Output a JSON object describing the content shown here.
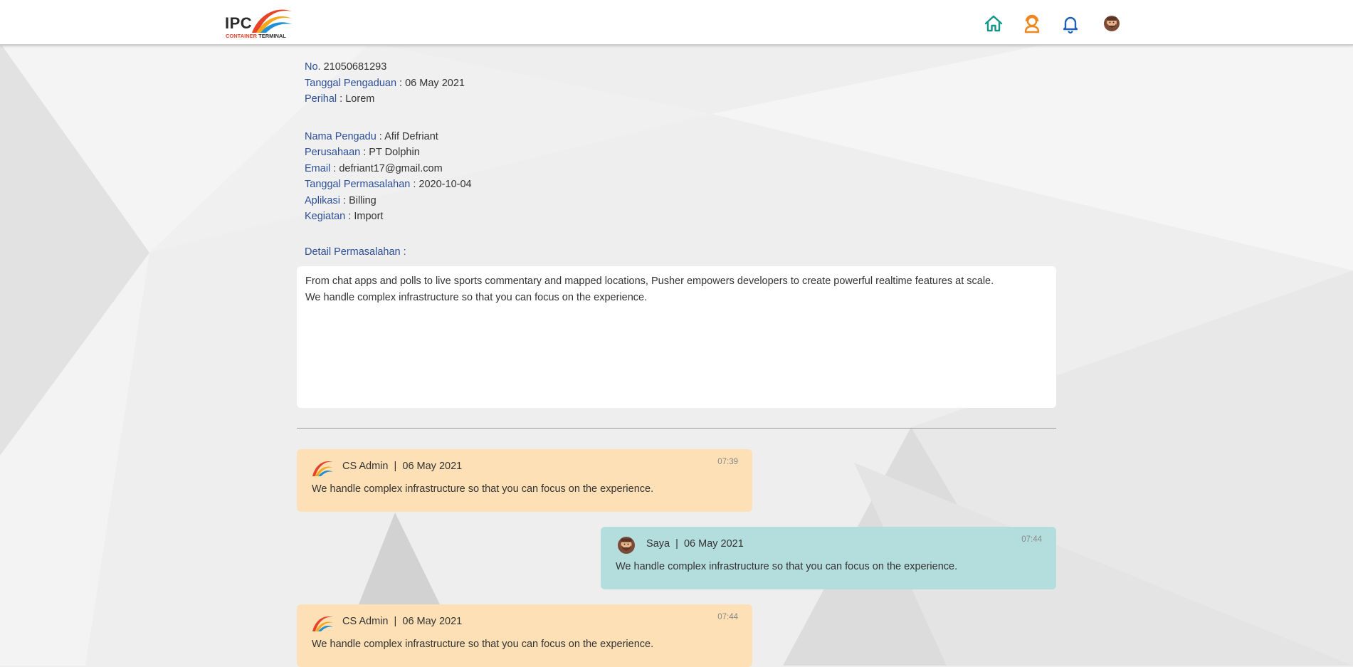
{
  "brand": {
    "logo_text": "IPC",
    "logo_sub_1": "CONTAINER",
    "logo_sub_2": "TERMINAL"
  },
  "nav": {
    "icons": [
      "home-icon",
      "support-agent-icon",
      "bell-icon",
      "user-avatar-icon"
    ],
    "colors": {
      "home": "#14958a",
      "support": "#f0861e",
      "bell": "#1f5fb8"
    }
  },
  "ticket": {
    "no_label": "No.",
    "no_value": "21050681293",
    "date_label": "Tanggal Pengaduan",
    "date_value": "06 May 2021",
    "subject_label": "Perihal",
    "subject_value": "Lorem",
    "name_label": "Nama Pengadu",
    "name_value": "Afif Defriant",
    "company_label": "Perusahaan",
    "company_value": "PT Dolphin",
    "email_label": "Email",
    "email_value": "defriant17@gmail.com",
    "problem_date_label": "Tanggal Permasalahan",
    "problem_date_value": "2020-10-04",
    "app_label": "Aplikasi",
    "app_value": "Billing",
    "activity_label": "Kegiatan",
    "activity_value": "Import",
    "detail_label": "Detail Permasalahan :",
    "detail_text": "From chat apps and polls to live sports commentary and mapped locations, Pusher empowers developers to create powerful realtime features at scale.\nWe handle complex infrastructure so that you can focus on the experience."
  },
  "messages": [
    {
      "sender": "CS Admin",
      "date": "06 May 2021",
      "time": "07:39",
      "text": "We handle complex infrastructure so that you can focus on the experience.",
      "side": "left",
      "color": "#fde0b5"
    },
    {
      "sender": "Saya",
      "date": "06 May 2021",
      "time": "07:44",
      "text": "We handle complex infrastructure so that you can focus on the experience.",
      "side": "right",
      "color": "#b4dedd"
    },
    {
      "sender": "CS Admin",
      "date": "06 May 2021",
      "time": "07:44",
      "text": "We handle complex infrastructure so that you can focus on the experience.",
      "side": "left",
      "color": "#fde0b5"
    }
  ]
}
